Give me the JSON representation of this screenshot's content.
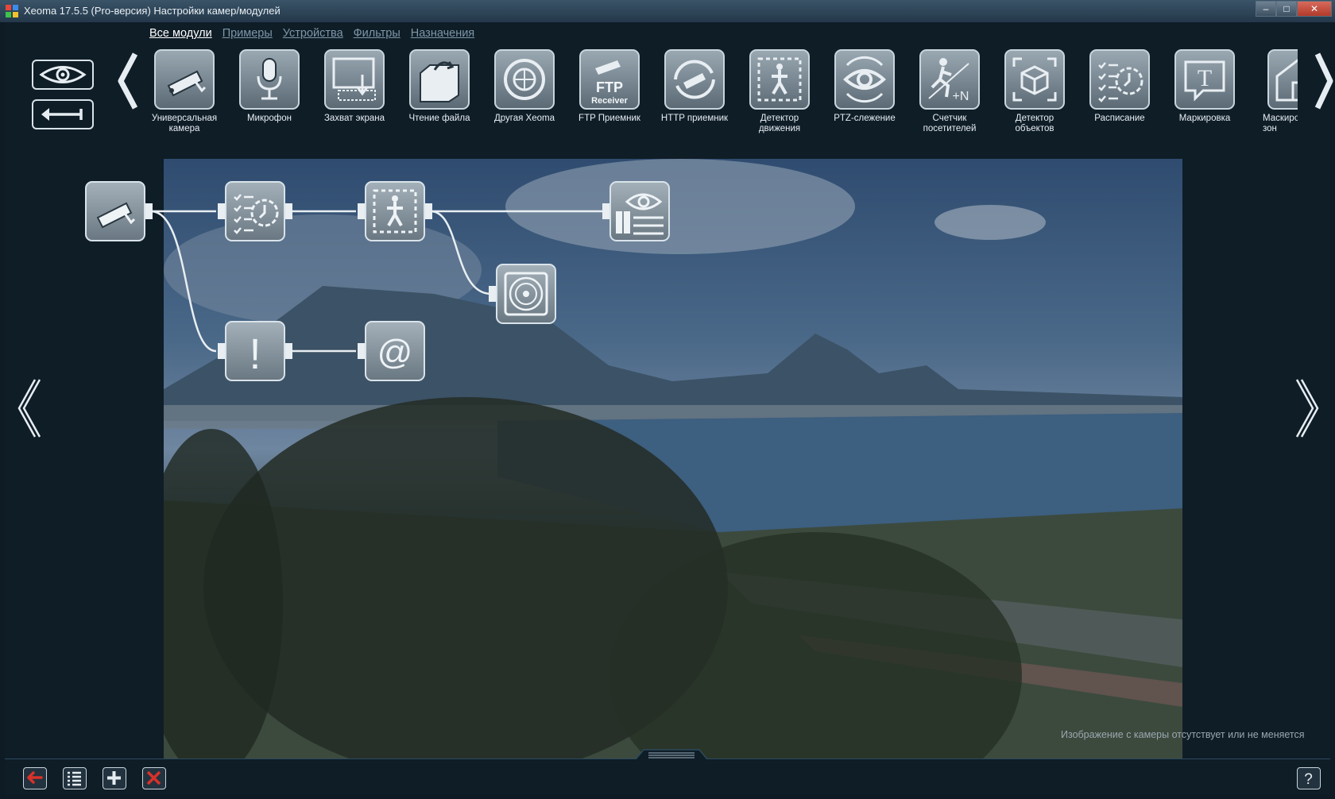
{
  "window": {
    "title": "Xeoma 17.5.5 (Pro-версия) Настройки камер/модулей",
    "controls": [
      "minimize",
      "maximize",
      "close"
    ]
  },
  "tabs": [
    {
      "label": "Все модули",
      "active": true
    },
    {
      "label": "Примеры",
      "active": false
    },
    {
      "label": "Устройства",
      "active": false
    },
    {
      "label": "Фильтры",
      "active": false
    },
    {
      "label": "Назначения",
      "active": false
    }
  ],
  "modules": [
    {
      "label": "Универсальная камера",
      "icon": "camera-icon"
    },
    {
      "label": "Микрофон",
      "icon": "microphone-icon"
    },
    {
      "label": "Захват экрана",
      "icon": "screen-capture-icon"
    },
    {
      "label": "Чтение файла",
      "icon": "file-read-icon"
    },
    {
      "label": "Другая Xeoma",
      "icon": "other-xeoma-icon"
    },
    {
      "label": "FTP Приемник",
      "icon": "ftp-receiver-icon"
    },
    {
      "label": "HTTP приемник",
      "icon": "http-receiver-icon"
    },
    {
      "label": "Детектор движения",
      "icon": "motion-detector-icon"
    },
    {
      "label": "PTZ-слежение",
      "icon": "ptz-tracking-icon"
    },
    {
      "label": "Счетчик посетителей",
      "icon": "visitors-counter-icon"
    },
    {
      "label": "Детектор объектов",
      "icon": "object-detector-icon"
    },
    {
      "label": "Расписание",
      "icon": "schedule-icon"
    },
    {
      "label": "Маркировка",
      "icon": "marking-icon"
    },
    {
      "label": "Маскирование зон",
      "icon": "zone-masking-icon"
    }
  ],
  "ftp_icon_text": {
    "line1": "FTP",
    "line2": "Receiver"
  },
  "chain_nodes": [
    {
      "name": "camera",
      "icon": "camera-icon"
    },
    {
      "name": "schedule",
      "icon": "schedule-icon"
    },
    {
      "name": "motion-detector",
      "icon": "motion-detector-icon"
    },
    {
      "name": "preview-archive",
      "icon": "preview-archive-icon"
    },
    {
      "name": "archive",
      "icon": "archive-disk-icon"
    },
    {
      "name": "problems-detector",
      "icon": "exclamation-icon"
    },
    {
      "name": "email-sending",
      "icon": "email-at-icon"
    }
  ],
  "email_symbol": "@",
  "exclamation_symbol": "!",
  "status_message": "Изображение с камеры отсутствует или не меняется",
  "bottom_buttons": [
    "back-red-icon",
    "list-icon",
    "add-icon",
    "delete-icon"
  ],
  "help_label": "?"
}
